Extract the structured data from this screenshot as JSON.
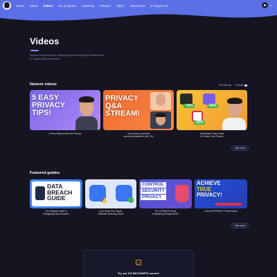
{
  "nav": {
    "items": [
      {
        "label": "Home",
        "active": false
      },
      {
        "label": "About",
        "active": false
      },
      {
        "label": "Videos",
        "active": true
      },
      {
        "label": "Go Incognito",
        "active": false
      },
      {
        "label": "Coaching",
        "active": false
      },
      {
        "label": "Privacy",
        "active": false,
        "dropdown": true
      },
      {
        "label": "Blog",
        "active": false,
        "dropdown": true
      },
      {
        "label": "Resources",
        "active": false
      },
      {
        "label": "Support Us",
        "active": false,
        "icon": "heart-icon"
      }
    ]
  },
  "hero": {
    "title": "Videos",
    "description": "Explore our video library, featuring expert insights and practical tips on digital rights and privacy."
  },
  "newest": {
    "heading": "Newest videos",
    "links": [
      {
        "label": "Our Feed",
        "icon": "rss-icon"
      },
      {
        "label": "YouTube",
        "icon": "youtube-icon"
      }
    ],
    "videos": [
      {
        "thumb_text": [
          "5 EASY",
          "PRIVACY",
          "TIPS!"
        ],
        "caption": [
          "5 Easy Ways to Improve Privacy!"
        ]
      },
      {
        "thumb_text": [
          "PRIVACY",
          "Q&A",
          "STREAM!"
        ],
        "caption": [
          "Your privacy & security",
          "questions answered! (Nov '24)"
        ]
      },
      {
        "thumb_text": [
          "-75%",
          "-60%",
          "-62%"
        ],
        "caption": [
          "Best Black Friday Deals",
          "to Protect Your Privacy!"
        ]
      }
    ],
    "view_more": "View more"
  },
  "featured": {
    "heading": "Featured guides",
    "guides": [
      {
        "thumb_text": [
          "DATA",
          "BREACH",
          "GUIDE"
        ],
        "caption": [
          "The Ultimate Guide to",
          "Navigating Data Breaches"
        ]
      },
      {
        "thumb_text": [],
        "caption": [
          "Lock Down Your Signal:",
          "Ultimate Hardening Guide"
        ]
      },
      {
        "thumb_text": [
          "CONTROL",
          "SECURITY",
          "PRIVACY"
        ],
        "caption": [
          "The ULTIMATE Guide",
          "to Mastering GrapheneOS!"
        ]
      },
      {
        "thumb_text": [
          "ACHIEVE",
          "TRUE",
          "PRIVACY!"
        ],
        "caption": [
          "How to PROPERLY Threat Model"
        ]
      }
    ],
    "view_more": "View more"
  },
  "course": {
    "title": "Try our GO INCOGNITO course!"
  },
  "colors": {
    "header": "#5b6fe6",
    "background": "#141520",
    "accent": "#8a8fff"
  }
}
